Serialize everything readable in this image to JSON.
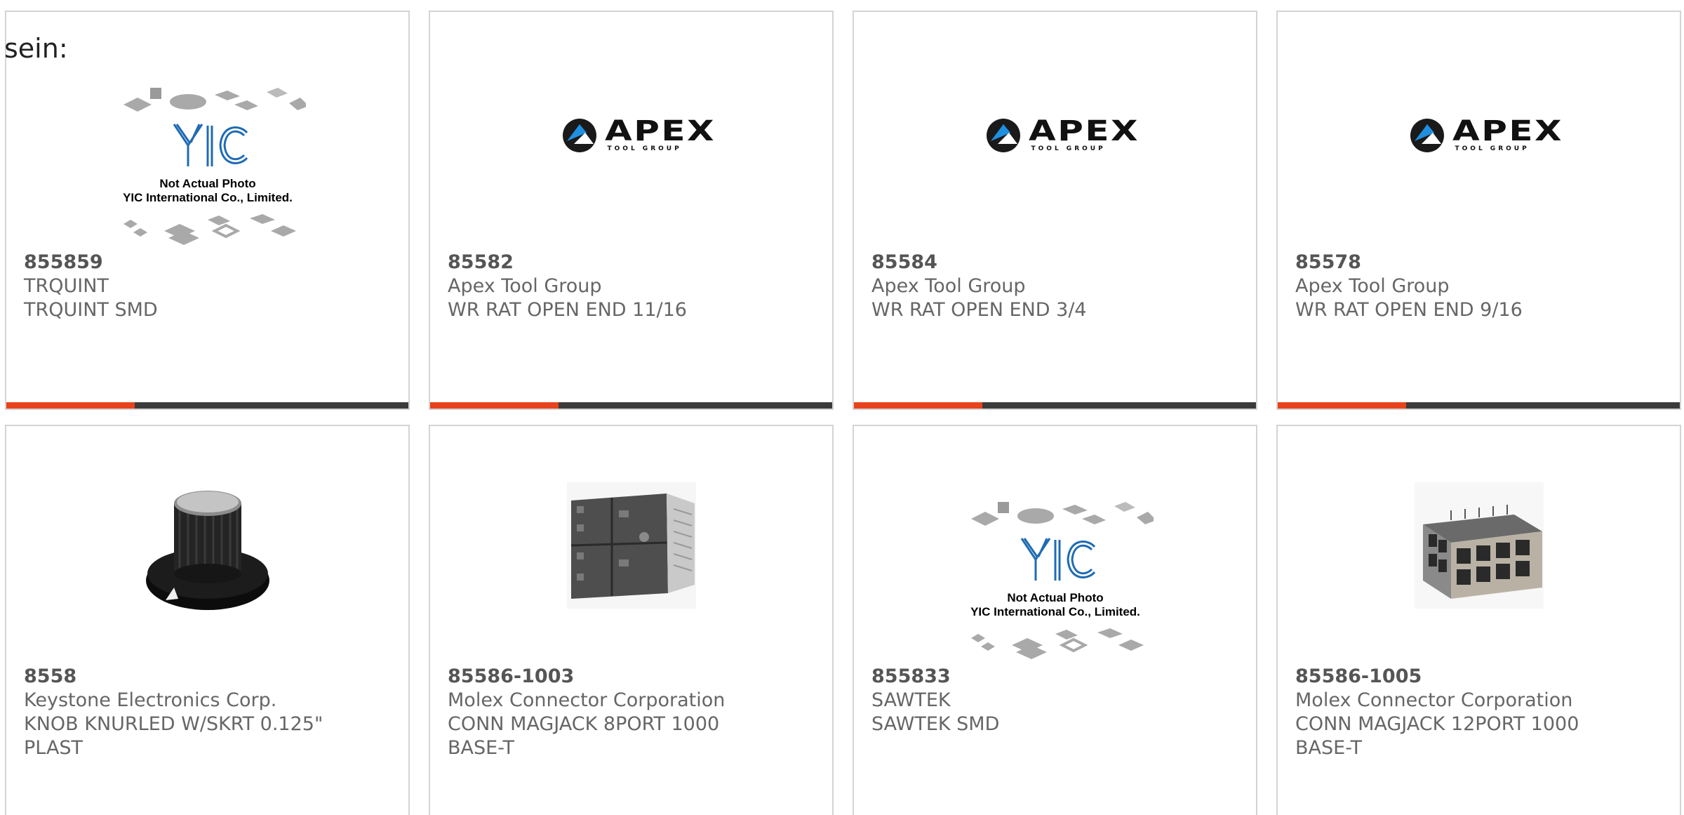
{
  "intro_text": "sein:",
  "colors": {
    "accent": "#e8431d",
    "bar": "#3b3b3b",
    "border": "#d4d4d4",
    "text": "#666666"
  },
  "placeholder": {
    "line1": "Not Actual Photo",
    "line2": "YIC International Co., Limited."
  },
  "apex_logo": {
    "word": "APEX",
    "sub": "TOOL GROUP"
  },
  "products": [
    {
      "part_number": "855859",
      "manufacturer": "TRQUINT",
      "desc1": "TRQUINT SMD",
      "desc2": "",
      "image": "yic-placeholder-icon"
    },
    {
      "part_number": "85582",
      "manufacturer": "Apex Tool Group",
      "desc1": "WR RAT OPEN END 11/16",
      "desc2": "",
      "image": "apex-logo-icon"
    },
    {
      "part_number": "85584",
      "manufacturer": "Apex Tool Group",
      "desc1": "WR RAT OPEN END 3/4",
      "desc2": "",
      "image": "apex-logo-icon"
    },
    {
      "part_number": "85578",
      "manufacturer": "Apex Tool Group",
      "desc1": "WR RAT OPEN END 9/16",
      "desc2": "",
      "image": "apex-logo-icon"
    },
    {
      "part_number": "8558",
      "manufacturer": "Keystone Electronics Corp.",
      "desc1": "KNOB KNURLED W/SKRT 0.125\"",
      "desc2": "PLAST",
      "image": "knob-icon"
    },
    {
      "part_number": "85586-1003",
      "manufacturer": "Molex Connector Corporation",
      "desc1": "CONN MAGJACK 8PORT 1000",
      "desc2": "BASE-T",
      "image": "magjack-8port-icon"
    },
    {
      "part_number": "855833",
      "manufacturer": "SAWTEK",
      "desc1": "SAWTEK SMD",
      "desc2": "",
      "image": "yic-placeholder-icon"
    },
    {
      "part_number": "85586-1005",
      "manufacturer": "Molex Connector Corporation",
      "desc1": "CONN MAGJACK 12PORT 1000",
      "desc2": "BASE-T",
      "image": "magjack-12port-icon"
    }
  ]
}
